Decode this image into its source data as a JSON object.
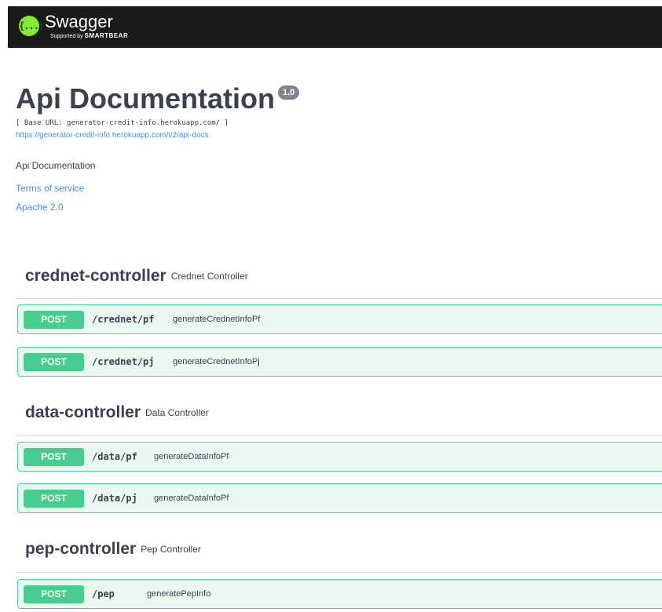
{
  "header": {
    "logo_icon": "{...}",
    "logo_text": "Swagger",
    "logo_supported_by": "Supported by",
    "logo_company": "SMARTBEAR"
  },
  "info": {
    "title": "Api Documentation",
    "version": "1.0",
    "base_url": "[ Base URL: generator-credit-info.herokuapp.com/ ]",
    "spec_url": "https://generator-credit-info.herokuapp.com/v2/api-docs",
    "description": "Api Documentation",
    "terms_of_service": "Terms of service",
    "license": "Apache 2.0"
  },
  "tags": [
    {
      "name": "crednet-controller",
      "description": "Crednet Controller",
      "operations": [
        {
          "method": "POST",
          "path": "/crednet/pf",
          "summary": "generateCrednetInfoPf"
        },
        {
          "method": "POST",
          "path": "/crednet/pj",
          "summary": "generateCrednetInfoPj"
        }
      ]
    },
    {
      "name": "data-controller",
      "description": "Data Controller",
      "operations": [
        {
          "method": "POST",
          "path": "/data/pf",
          "summary": "generateDataInfoPf"
        },
        {
          "method": "POST",
          "path": "/data/pj",
          "summary": "generateDataInfoPf"
        }
      ]
    },
    {
      "name": "pep-controller",
      "description": "Pep Controller",
      "operations": [
        {
          "method": "POST",
          "path": "/pep",
          "summary": "generatePepInfo"
        }
      ]
    }
  ],
  "colors": {
    "topbar": "#1b1b1b",
    "logo_green": "#85ea2d",
    "post_green": "#49cc90",
    "post_background": "#ebf8f1",
    "link_blue": "#4990e2",
    "version_badge": "#7d8492",
    "text": "#3b4151"
  }
}
